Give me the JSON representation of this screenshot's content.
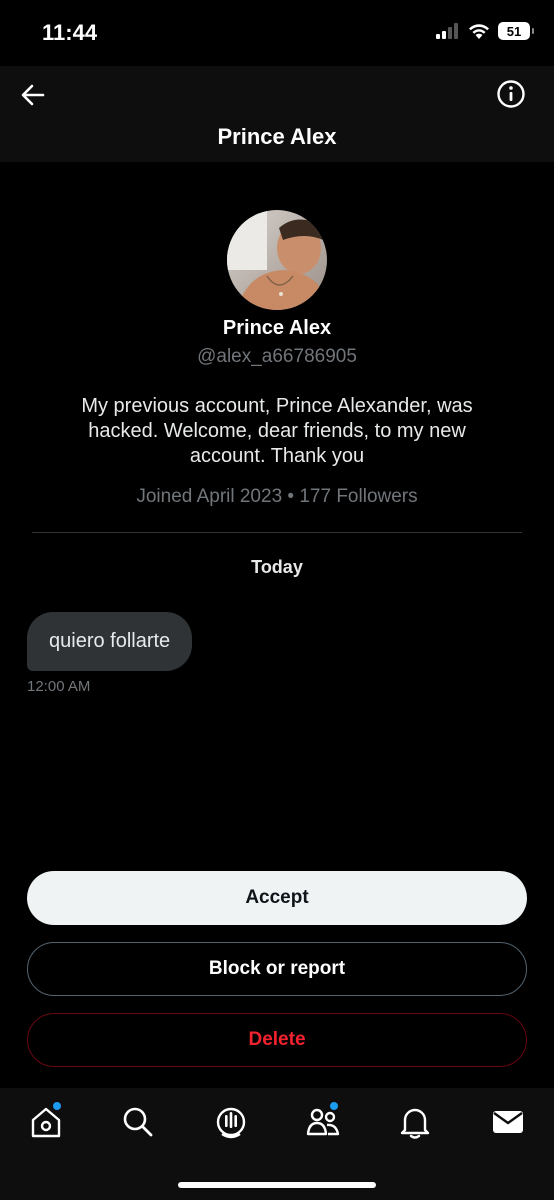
{
  "status_bar": {
    "time": "11:44",
    "battery": "51"
  },
  "header": {
    "title": "Prince Alex",
    "back_icon": "arrow-left-icon",
    "info_icon": "info-icon"
  },
  "profile": {
    "display_name": "Prince Alex",
    "handle": "@alex_a66786905",
    "bio": "My previous account, Prince Alexander, was hacked. Welcome, dear friends, to my new account. Thank you",
    "meta": "Joined April 2023 • 177 Followers"
  },
  "conversation": {
    "day_label": "Today",
    "messages": [
      {
        "text": "quiero follarte",
        "time": "12:00 AM"
      }
    ]
  },
  "actions": {
    "accept": "Accept",
    "block_report": "Block or report",
    "delete": "Delete"
  },
  "bottom_nav": {
    "items": [
      "home-icon",
      "search-icon",
      "spaces-icon",
      "communities-icon",
      "notifications-icon",
      "messages-icon"
    ],
    "badges": [
      "home",
      "communities"
    ]
  },
  "colors": {
    "accent": "#1d9bf0",
    "danger": "#f4212e",
    "background": "#000000"
  }
}
